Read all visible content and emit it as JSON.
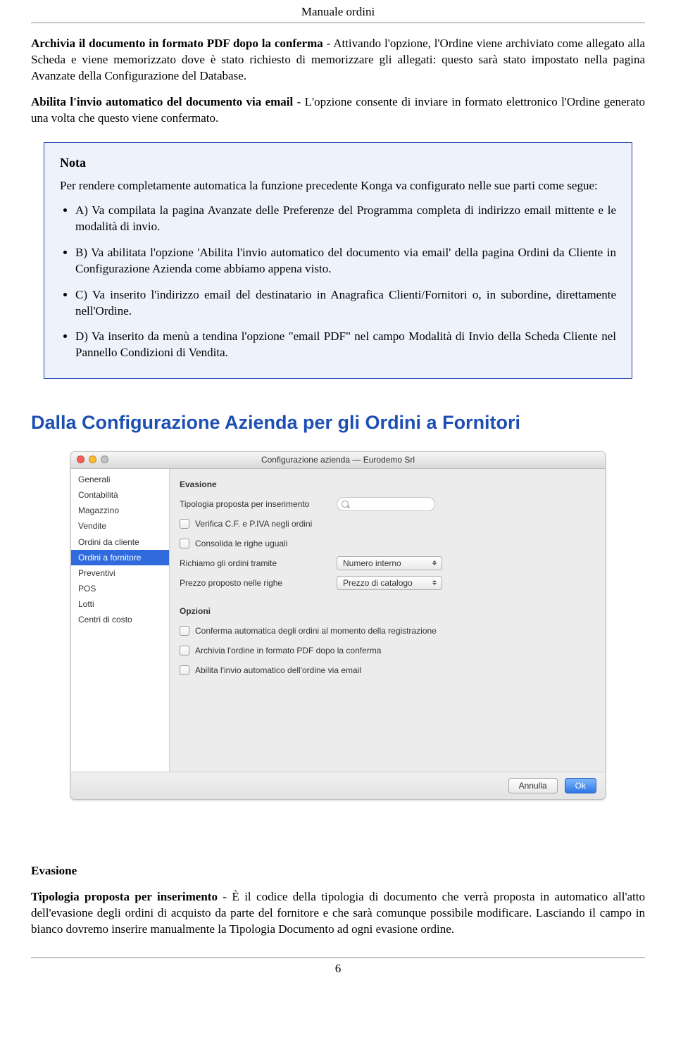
{
  "header": {
    "title": "Manuale ordini"
  },
  "paragraphs": {
    "p1_boldStart": "Archivia il documento in formato PDF dopo la conferma",
    "p1_rest": " - Attivando l'opzione, l'Ordine viene archiviato come allegato alla Scheda e viene memorizzato dove è stato richiesto di memorizzare gli allegati: questo sarà stato impostato nella pagina Avanzate della Configurazione del Database.",
    "p2_boldStart": "Abilita l'invio automatico del documento via email",
    "p2_rest": " - L'opzione consente di inviare in formato elettronico l'Ordine generato una volta che questo viene confermato."
  },
  "note": {
    "title": "Nota",
    "intro": "Per rendere completamente automatica la funzione precedente Konga va configurato nelle sue parti come segue:",
    "items": [
      "A) Va compilata la pagina Avanzate delle Preferenze del Programma completa di indirizzo email mittente e le modalità di invio.",
      "B) Va abilitata l'opzione 'Abilita l'invio automatico del documento via email' della pagina Ordini da Cliente in Configurazione Azienda come abbiamo appena visto.",
      "C) Va inserito l'indirizzo email del destinatario in Anagrafica Clienti/Fornitori o, in subordine, direttamente nell'Ordine.",
      "D) Va inserito da menù a tendina l'opzione \"email PDF\" nel campo Modalità di Invio della Scheda Cliente nel Pannello Condizioni di Vendita."
    ]
  },
  "section_heading": "Dalla Configurazione Azienda per gli Ordini a Fornitori",
  "window": {
    "title": "Configurazione azienda — Eurodemo Srl",
    "sidebar": [
      "Generali",
      "Contabilità",
      "Magazzino",
      "Vendite",
      "Ordini da cliente",
      "Ordini a fornitore",
      "Preventivi",
      "POS",
      "Lotti",
      "Centri di costo"
    ],
    "selected_index": 5,
    "groups": {
      "evasione": "Evasione",
      "opzioni": "Opzioni"
    },
    "rows": {
      "tipologia_label": "Tipologia proposta per inserimento",
      "verifica_label": "Verifica C.F. e P.IVA negli ordini",
      "consolida_label": "Consolida le righe uguali",
      "richiamo_label": "Richiamo gli ordini tramite",
      "richiamo_value": "Numero interno",
      "prezzo_label": "Prezzo proposto nelle righe",
      "prezzo_value": "Prezzo di catalogo",
      "opt1": "Conferma automatica degli ordini al momento della registrazione",
      "opt2": "Archivia l'ordine in formato PDF dopo la conferma",
      "opt3": "Abilita l'invio automatico dell'ordine via email"
    },
    "buttons": {
      "cancel": "Annulla",
      "ok": "Ok"
    }
  },
  "bottom": {
    "evasione_title": "Evasione",
    "p_boldStart": "Tipologia proposta per inserimento",
    "p_rest": " - È il codice della tipologia di documento che verrà proposta in automatico all'atto dell'evasione degli ordini di acquisto da parte del fornitore e che sarà comunque possibile modificare. Lasciando il campo in bianco dovremo inserire manualmente la Tipologia Documento ad ogni evasione ordine."
  },
  "page_number": "6"
}
